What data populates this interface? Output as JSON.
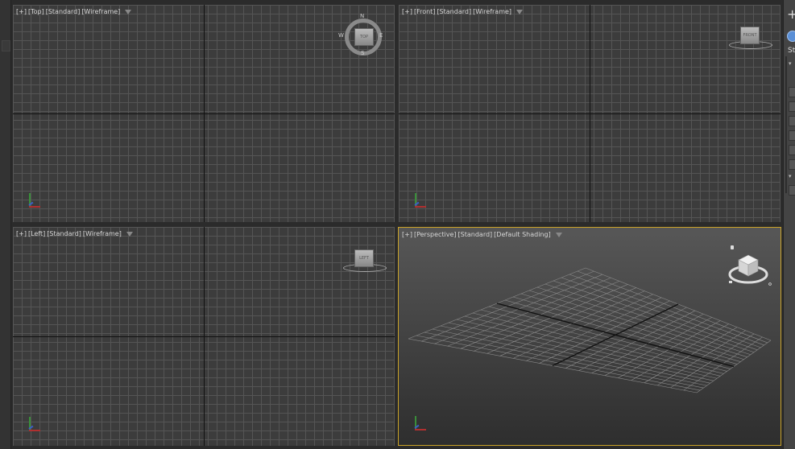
{
  "viewports": {
    "top": {
      "plus": "[+]",
      "view": "[Top]",
      "mode": "[Standard]",
      "shading": "[Wireframe]"
    },
    "front": {
      "plus": "[+]",
      "view": "[Front]",
      "mode": "[Standard]",
      "shading": "[Wireframe]"
    },
    "left": {
      "plus": "[+]",
      "view": "[Left]",
      "mode": "[Standard]",
      "shading": "[Wireframe]"
    },
    "perspective": {
      "plus": "[+]",
      "view": "[Perspective]",
      "mode": "[Standard]",
      "shading": "[Default Shading]"
    }
  },
  "viewcube": {
    "top_face": "TOP",
    "front_face": "FRONT",
    "left_face": "LEFT"
  },
  "compass": {
    "n": "N",
    "s": "S",
    "e": "E",
    "w": "W"
  },
  "right_panel": {
    "create_glyph": "+",
    "standard_label": "St"
  },
  "colors": {
    "active_border": "#c9a227",
    "axis_x": "#b03030",
    "axis_y": "#3b5fc4",
    "axis_z": "#3a8f3a"
  }
}
